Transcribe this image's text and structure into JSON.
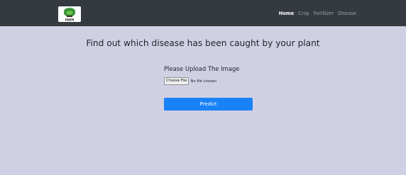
{
  "navbar": {
    "logo_text": "FARM",
    "links": [
      {
        "label": "Home",
        "active": true
      },
      {
        "label": "Crop",
        "active": false
      },
      {
        "label": "Fertilizer",
        "active": false
      },
      {
        "label": "Disease",
        "active": false
      }
    ]
  },
  "main": {
    "title": "Find out which disease has been caught by your plant",
    "upload_label": "Please Upload The Image",
    "file_button_label": "Choose File",
    "file_status": "No file chosen",
    "predict_label": "Predict"
  },
  "colors": {
    "navbar_bg": "#343a40",
    "page_bg": "#d0d0e4",
    "primary": "#1a82f7"
  }
}
